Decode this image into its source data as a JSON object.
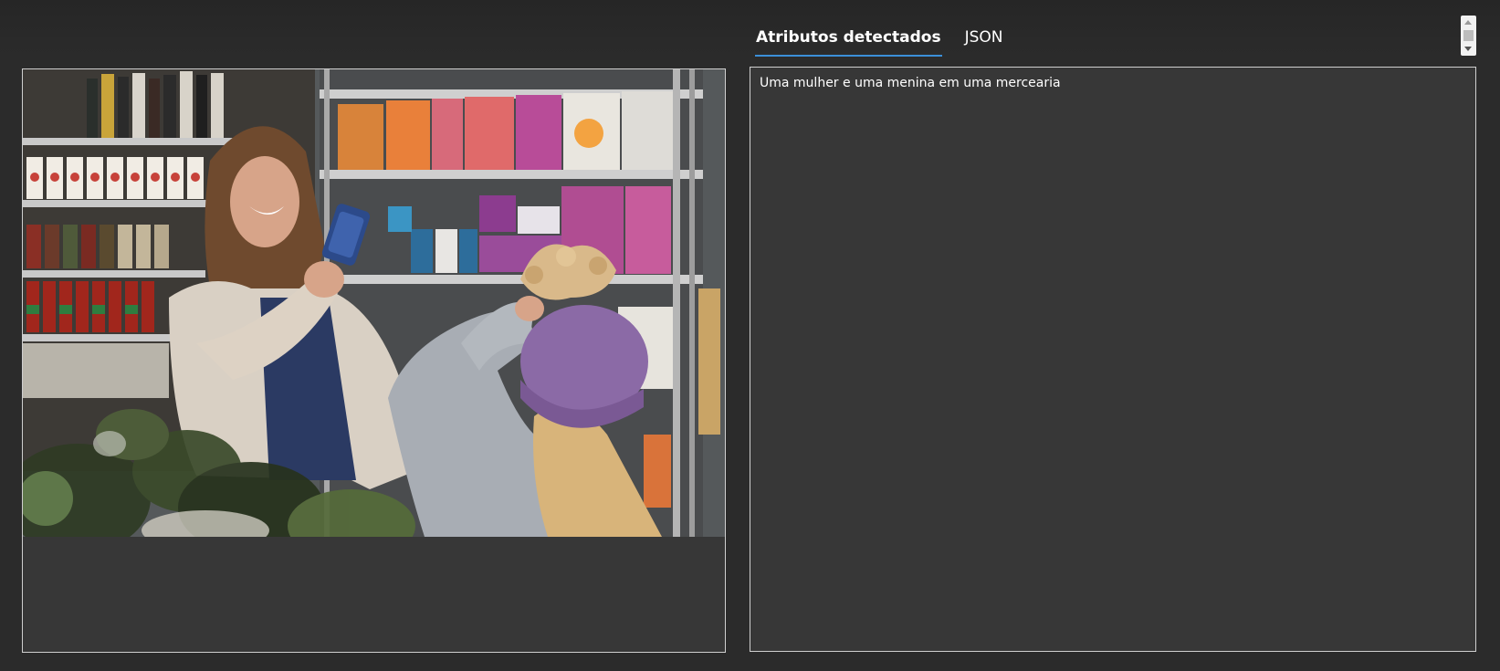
{
  "tabs": [
    {
      "label": "Atributos detectados",
      "active": true
    },
    {
      "label": "JSON",
      "active": false
    }
  ],
  "result": {
    "caption": "Uma mulher e uma menina em uma mercearia"
  },
  "image": {
    "subject": "woman photographing girl in grocery store"
  },
  "colors": {
    "background": "#2b2b2b",
    "panel": "#373737",
    "tab_underline": "#3b8fd9"
  }
}
